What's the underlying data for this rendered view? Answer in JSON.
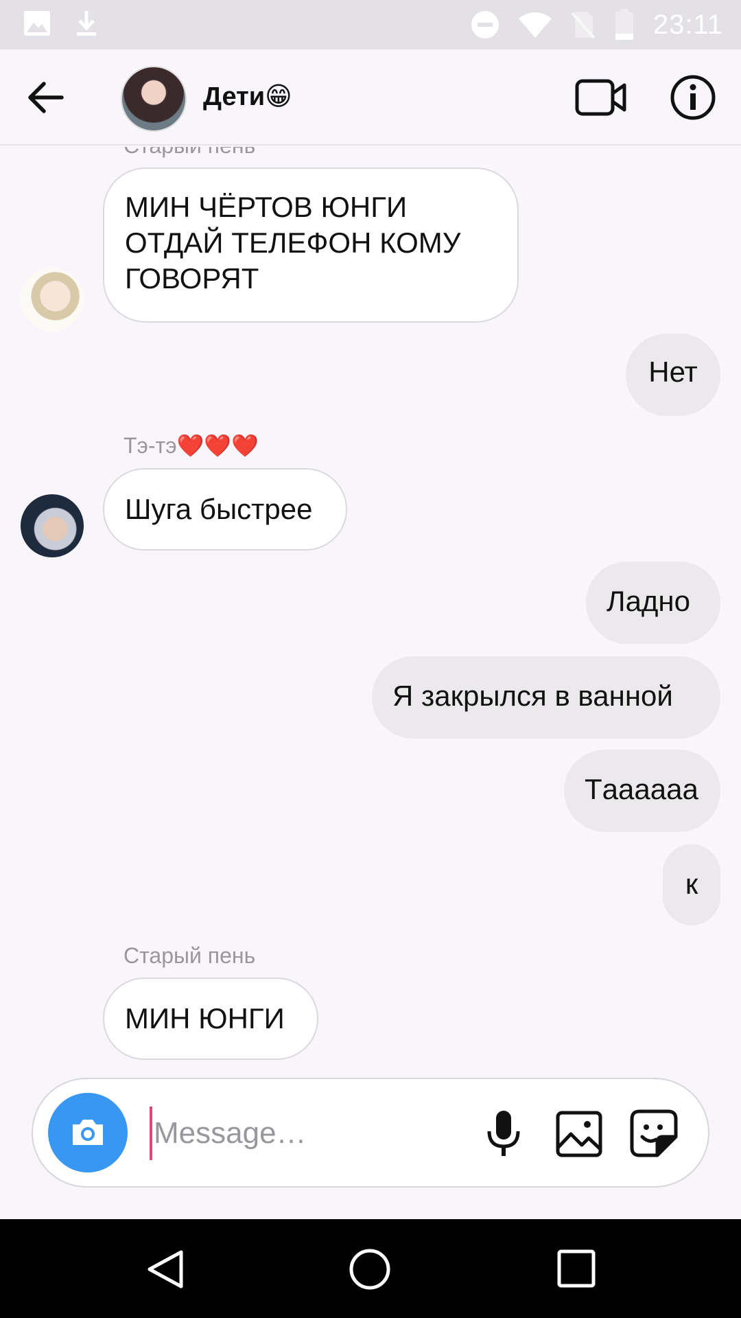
{
  "status_bar": {
    "time": "23:11",
    "icons": [
      "image-icon",
      "download-icon",
      "dnd-icon",
      "wifi-icon",
      "no-sim-icon",
      "battery-icon"
    ]
  },
  "header": {
    "title": "Дети😁",
    "icons": [
      "back-arrow-icon",
      "video-call-icon",
      "info-icon"
    ]
  },
  "messages": [
    {
      "type": "label",
      "text": "Старый пень"
    },
    {
      "type": "in",
      "sender_avatar": "suga",
      "lines": [
        "МИН ЧЁРТОВ ЮНГИ",
        "ОТДАЙ ТЕЛЕФОН КОМУ",
        "ГОВОРЯТ"
      ]
    },
    {
      "type": "out",
      "text": "Нет"
    },
    {
      "type": "label",
      "text": "Тэ-тэ❤️❤️❤️"
    },
    {
      "type": "in",
      "sender_avatar": "tae",
      "text": "Шуга быстрее"
    },
    {
      "type": "out",
      "text": "Ладно"
    },
    {
      "type": "out",
      "text": "Я закрылся в ванной"
    },
    {
      "type": "out",
      "text": "Тaaaaaa"
    },
    {
      "type": "out",
      "text": "к"
    },
    {
      "type": "label",
      "text": "Старый пень"
    },
    {
      "type": "in",
      "text": "МИН ЮНГИ"
    }
  ],
  "composer": {
    "placeholder": "Message…",
    "value": "",
    "icons": [
      "camera-icon",
      "microphone-icon",
      "gallery-icon",
      "sticker-icon"
    ]
  },
  "nav_bar": {
    "icons": [
      "nav-back-icon",
      "nav-home-icon",
      "nav-recents-icon"
    ]
  },
  "colors": {
    "accent": "#3897f0",
    "heart": "#e0457b",
    "background": "#f8f6fa",
    "outgoing_bubble": "#ebe9ec"
  }
}
